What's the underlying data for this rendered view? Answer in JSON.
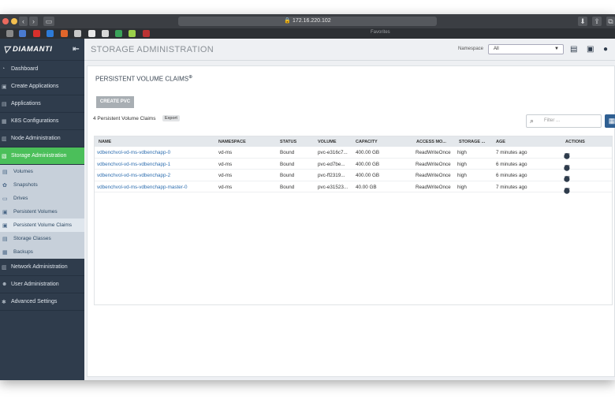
{
  "browser": {
    "url": "172.16.220.102",
    "favorites_label": "Favorites"
  },
  "app": {
    "logo_text": "DIAMANTI",
    "page_title": "STORAGE ADMINISTRATION",
    "namespace_label": "Namespace",
    "namespace_value": "All"
  },
  "sidebar": {
    "items": [
      {
        "label": "Dashboard",
        "icon": "dashboard-icon"
      },
      {
        "label": "Create Applications",
        "icon": "create-icon"
      },
      {
        "label": "Applications",
        "icon": "apps-icon"
      },
      {
        "label": "K8S Configurations",
        "icon": "k8s-icon"
      },
      {
        "label": "Node Administration",
        "icon": "node-icon"
      },
      {
        "label": "Storage Administration",
        "icon": "storage-icon"
      }
    ],
    "subitems": [
      {
        "label": "Volumes"
      },
      {
        "label": "Snapshots"
      },
      {
        "label": "Drives"
      },
      {
        "label": "Persistent Volumes"
      },
      {
        "label": "Persistent Volume Claims"
      },
      {
        "label": "Storage Classes"
      },
      {
        "label": "Backups"
      }
    ],
    "bottom_items": [
      {
        "label": "Network Administration"
      },
      {
        "label": "User Administration"
      },
      {
        "label": "Advanced Settings"
      }
    ]
  },
  "panel": {
    "title": "PERSISTENT VOLUME CLAIMS",
    "create_label": "CREATE PVC",
    "count_text": "4 Persistent Volume Claims",
    "export_label": "Export",
    "filter_placeholder": "Filter ..."
  },
  "table": {
    "headers": [
      "NAME",
      "NAMESPACE",
      "STATUS",
      "VOLUME",
      "CAPACITY",
      "ACCESS MO...",
      "STORAGE ...",
      "AGE",
      "ACTIONS"
    ],
    "rows": [
      [
        "vdbenchvol-vd-ms-vdbenchapp-0",
        "vd-ms",
        "Bound",
        "pvc-e316c7...",
        "400.00 GB",
        "ReadWriteOnce",
        "high",
        "7 minutes ago"
      ],
      [
        "vdbenchvol-vd-ms-vdbenchapp-1",
        "vd-ms",
        "Bound",
        "pvc-ed7be...",
        "400.00 GB",
        "ReadWriteOnce",
        "high",
        "6 minutes ago"
      ],
      [
        "vdbenchvol-vd-ms-vdbenchapp-2",
        "vd-ms",
        "Bound",
        "pvc-ff2319...",
        "400.00 GB",
        "ReadWriteOnce",
        "high",
        "6 minutes ago"
      ],
      [
        "vdbenchvol-vd-ms-vdbenchapp-master-0",
        "vd-ms",
        "Bound",
        "pvc-e31523...",
        "40.00 GB",
        "ReadWriteOnce",
        "high",
        "7 minutes ago"
      ]
    ]
  },
  "colors": {
    "sidebar_bg": "#2f3c4c",
    "active_green": "#4bbf5a",
    "link_blue": "#2f6fb0"
  }
}
